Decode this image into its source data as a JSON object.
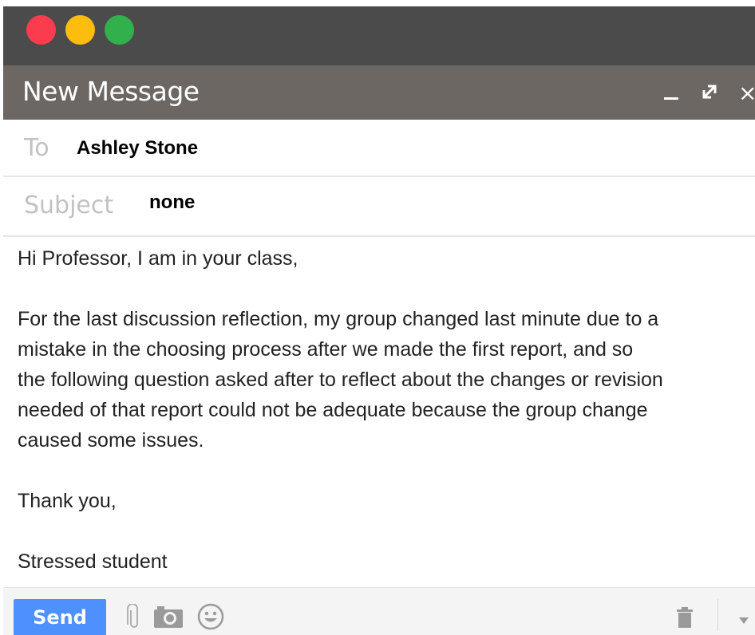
{
  "window": {
    "traffic_lights": [
      "close",
      "minimize",
      "zoom"
    ],
    "colors": {
      "red": "#fb3b4e",
      "yellow": "#fdbd0e",
      "green": "#31b04b"
    }
  },
  "header": {
    "title": "New Message",
    "minimize_icon": "minimize-icon",
    "expand_icon": "expand-icon",
    "close_icon": "close-icon",
    "close_glyph": "×",
    "expand_glyph": "⤢",
    "background": "#6c6763"
  },
  "to": {
    "label": "To",
    "value": "Ashley Stone"
  },
  "subject": {
    "label": "Subject",
    "value": "none"
  },
  "body": {
    "text": "Hi Professor, I am in your class,\n\nFor the last discussion reflection, my group changed last minute due to a\nmistake in the choosing process after we made the first report, and so\nthe following question asked after to reflect about the changes or revision\nneeded of that report could not be adequate because the group change\ncaused some issues.\n\nThank you,\n\nStressed student"
  },
  "toolbar": {
    "send_label": "Send",
    "send_color": "#4d90fe",
    "icons": [
      "paperclip-icon",
      "camera-icon",
      "emoji-icon",
      "trash-icon",
      "dropdown-arrow-icon"
    ]
  }
}
